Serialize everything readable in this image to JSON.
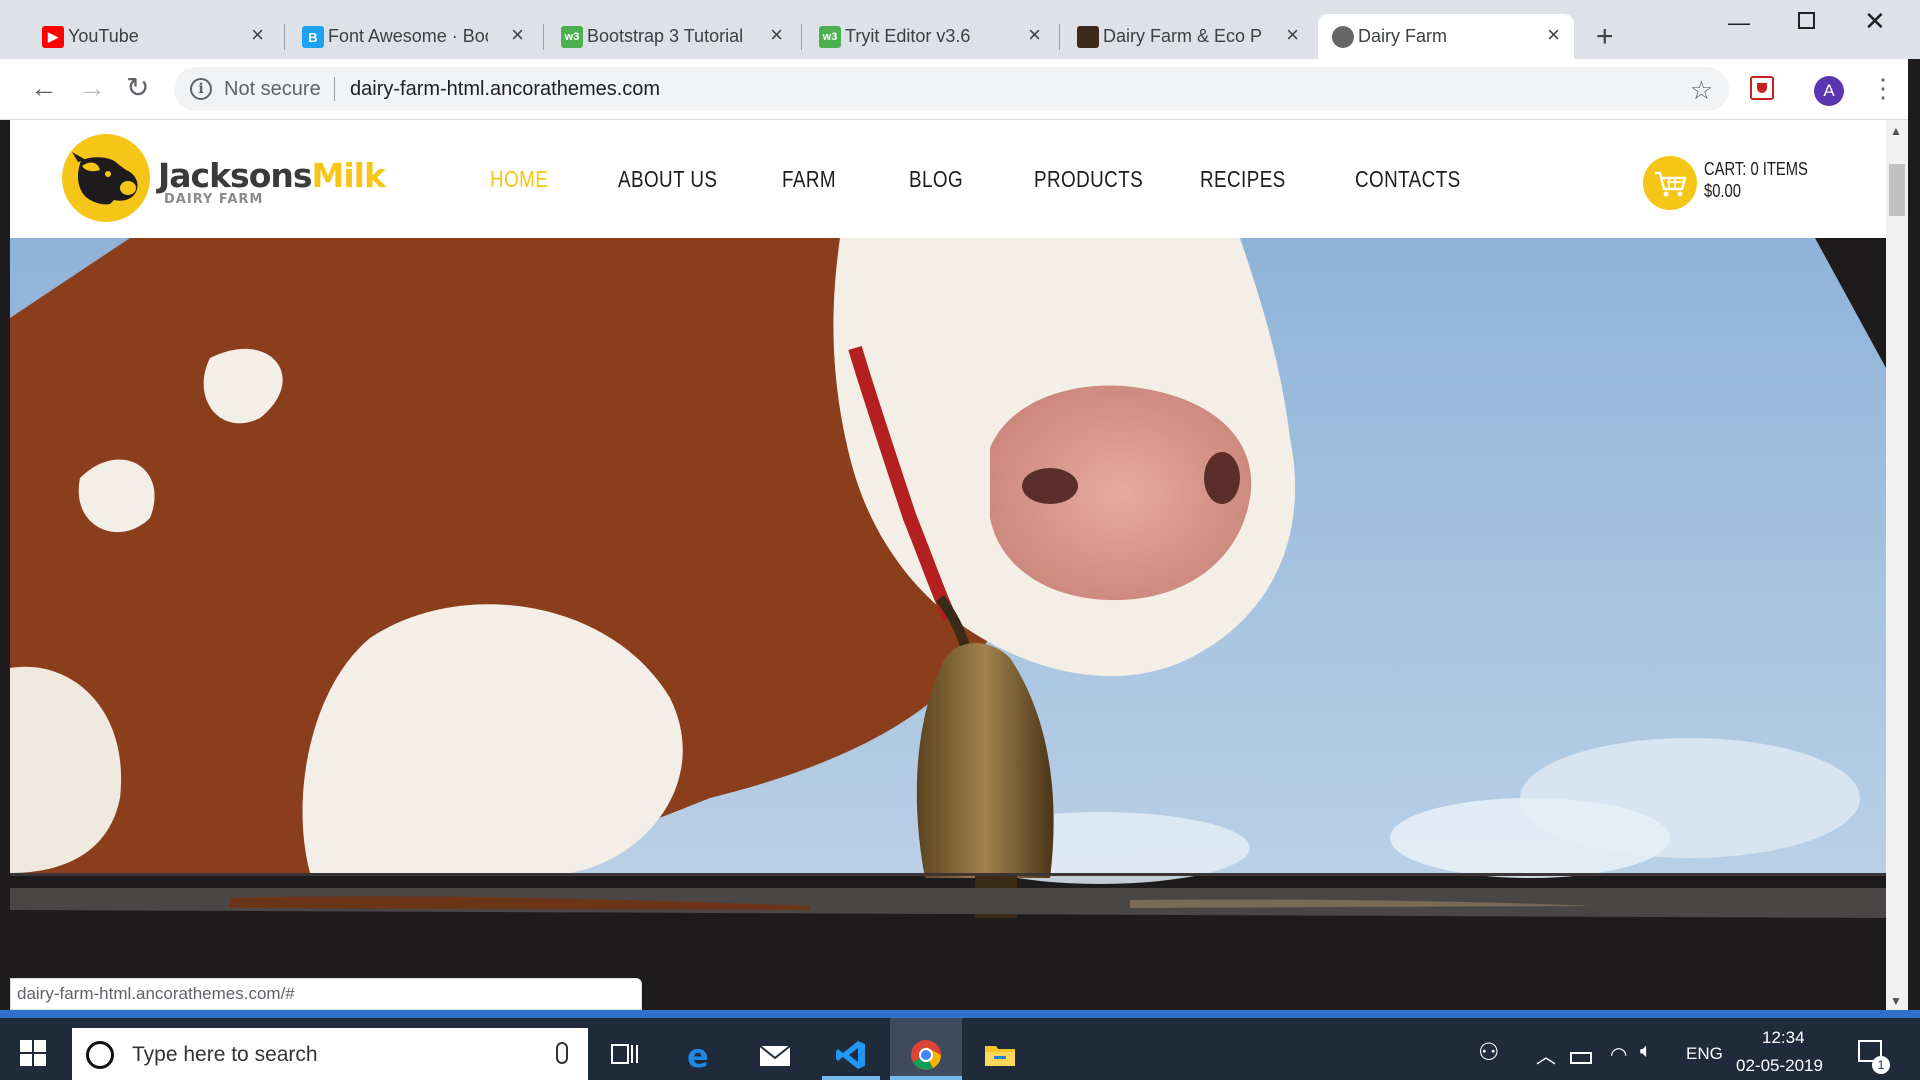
{
  "browser": {
    "tabs": [
      {
        "label": "YouTube",
        "icon": "youtube-icon"
      },
      {
        "label": "Font Awesome · Boo",
        "icon": "bootstrap-icon"
      },
      {
        "label": "Bootstrap 3 Tutorial",
        "icon": "w3schools-icon"
      },
      {
        "label": "Tryit Editor v3.6",
        "icon": "w3schools-icon"
      },
      {
        "label": "Dairy Farm & Eco Pr",
        "icon": "site-icon"
      },
      {
        "label": "Dairy Farm",
        "icon": "site-icon",
        "active": true
      }
    ],
    "not_secure": "Not secure",
    "url": "dairy-farm-html.ancorathemes.com",
    "profile_initial": "A",
    "status_link": "dairy-farm-html.ancorathemes.com/#"
  },
  "site": {
    "logo": {
      "name_part1": "Jacksons",
      "name_part2": "Milk",
      "subtitle": "DAIRY FARM"
    },
    "nav": [
      {
        "label": "HOME",
        "active": true
      },
      {
        "label": "ABOUT US"
      },
      {
        "label": "FARM"
      },
      {
        "label": "BLOG"
      },
      {
        "label": "PRODUCTS"
      },
      {
        "label": "RECIPES"
      },
      {
        "label": "CONTACTS"
      }
    ],
    "cart": {
      "items": "CART: 0 ITEMS",
      "total": "$0.00"
    },
    "accent_color": "#f5c518",
    "dark_color": "#1e1b1c",
    "back_to_top_icon": "chevron-up-icon"
  },
  "taskbar": {
    "search_placeholder": "Type here to search",
    "language": "ENG",
    "time": "12:34",
    "date": "02-05-2019",
    "notification_count": "1",
    "pinned": [
      "task-view-icon",
      "edge-icon",
      "mail-icon",
      "vscode-icon",
      "chrome-icon",
      "file-explorer-icon"
    ]
  }
}
